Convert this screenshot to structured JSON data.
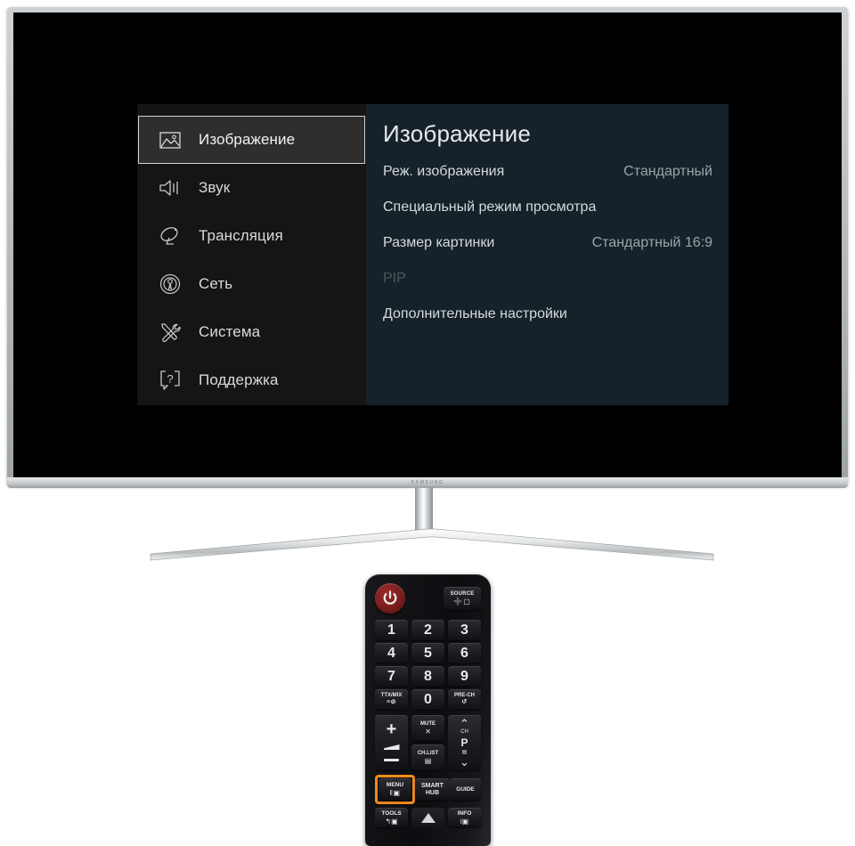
{
  "tv": {
    "brand_logo": "SAMSUNG",
    "menu": {
      "sidebar": {
        "items": [
          {
            "label": "Изображение",
            "icon": "picture-icon",
            "selected": true
          },
          {
            "label": "Звук",
            "icon": "speaker-icon",
            "selected": false
          },
          {
            "label": "Трансляция",
            "icon": "satellite-dish-icon",
            "selected": false
          },
          {
            "label": "Сеть",
            "icon": "broadcast-tower-icon",
            "selected": false
          },
          {
            "label": "Система",
            "icon": "tools-icon",
            "selected": false
          },
          {
            "label": "Поддержка",
            "icon": "help-bubble-icon",
            "selected": false
          }
        ]
      },
      "content": {
        "title": "Изображение",
        "rows": [
          {
            "label": "Реж. изображения",
            "value": "Стандартный",
            "disabled": false
          },
          {
            "label": "Специальный режим просмотра",
            "value": "",
            "disabled": false
          },
          {
            "label": "Размер картинки",
            "value": "Стандартный 16:9",
            "disabled": false
          },
          {
            "label": "PIP",
            "value": "",
            "disabled": true
          },
          {
            "label": "Дополнительные настройки",
            "value": "",
            "disabled": false
          }
        ]
      }
    }
  },
  "remote": {
    "power_label": "power-button",
    "source": {
      "text": "SOURCE",
      "glyph": "➕▢"
    },
    "numbers": [
      "1",
      "2",
      "3",
      "4",
      "5",
      "6",
      "7",
      "8",
      "9"
    ],
    "ttx": {
      "text": "TTX/MIX",
      "glyph": "≡⊘"
    },
    "zero": "0",
    "prech": {
      "text": "PRE-CH",
      "glyph": "↺"
    },
    "volume": {
      "plus": "+",
      "minus": "−"
    },
    "mute": {
      "text": "MUTE",
      "glyph": "✕"
    },
    "chlist": {
      "text": "CH.LIST",
      "glyph": "▤"
    },
    "channel": {
      "up": "⌃",
      "p": "P",
      "down": "⌄",
      "top_mini": "CH",
      "bottom_mini": "▤"
    },
    "menu": {
      "text": "MENU",
      "glyph": "‖▣"
    },
    "smart_hub": {
      "line1": "SMART",
      "line2": "HUB"
    },
    "guide": "GUIDE",
    "tools": {
      "text": "TOOLS",
      "glyph": "↰▣"
    },
    "info": {
      "text": "INFO",
      "glyph": "i▣"
    },
    "up_arrow": "up-arrow",
    "highlight_color": "#f08a1e"
  }
}
